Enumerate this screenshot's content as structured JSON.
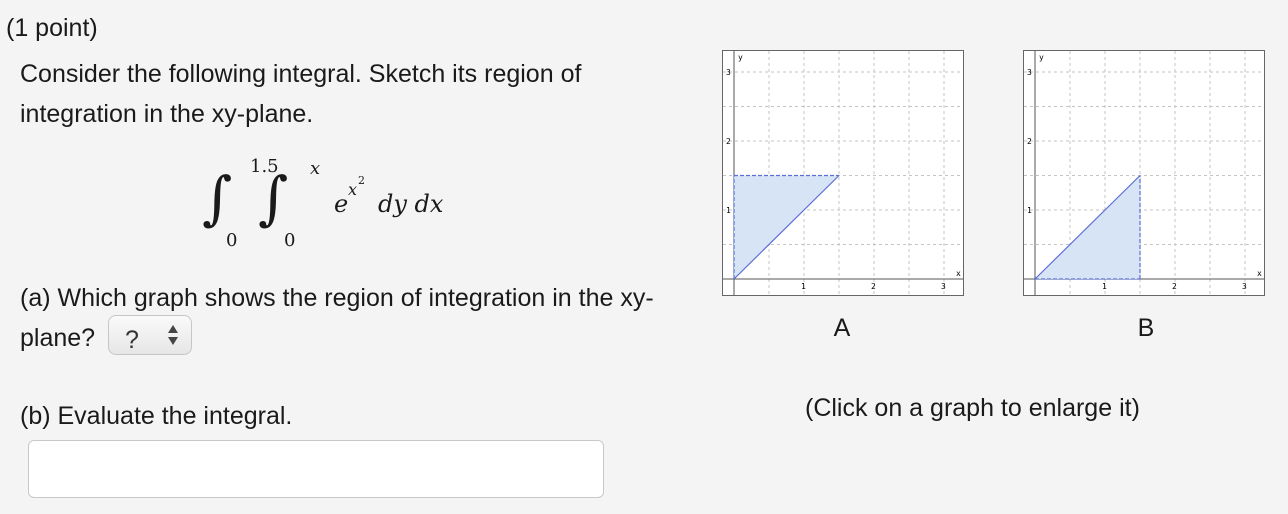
{
  "problem": {
    "points": "(1 point)",
    "prompt": "Consider the following integral. Sketch its region of integration in the xy-plane."
  },
  "integral": {
    "outer_upper": "1.5",
    "outer_lower": "0",
    "inner_upper": "x",
    "inner_lower": "0",
    "integrand_base": "e",
    "integrand_exponent": "x",
    "integrand_exponent_power": "2",
    "differentials": "dy dx"
  },
  "part_a": {
    "text": "(a) Which graph shows the region of integration in the xy-plane?",
    "select_value": "?"
  },
  "part_b": {
    "text": "(b) Evaluate the integral.",
    "answer_value": ""
  },
  "graphs": [
    {
      "label": "A",
      "x_axis_label": "x",
      "y_axis_label": "y",
      "x_ticks": [
        "1",
        "2",
        "3"
      ],
      "y_ticks": [
        "1",
        "2",
        "3"
      ],
      "xlim": [
        0,
        3.25
      ],
      "ylim": [
        0,
        3.3
      ],
      "region_vertices": [
        [
          0,
          0
        ],
        [
          0,
          1.5
        ],
        [
          1.5,
          1.5
        ]
      ],
      "fill_color": "#d6e4f5",
      "edge_color": "#5b6fd6"
    },
    {
      "label": "B",
      "x_axis_label": "x",
      "y_axis_label": "y",
      "x_ticks": [
        "1",
        "2",
        "3"
      ],
      "y_ticks": [
        "1",
        "2",
        "3"
      ],
      "xlim": [
        0,
        3.25
      ],
      "ylim": [
        0,
        3.3
      ],
      "region_vertices": [
        [
          0,
          0
        ],
        [
          1.5,
          0
        ],
        [
          1.5,
          1.5
        ]
      ],
      "fill_color": "#d6e4f5",
      "edge_color": "#5b6fd6"
    }
  ],
  "click_note": "(Click on a graph to enlarge it)"
}
